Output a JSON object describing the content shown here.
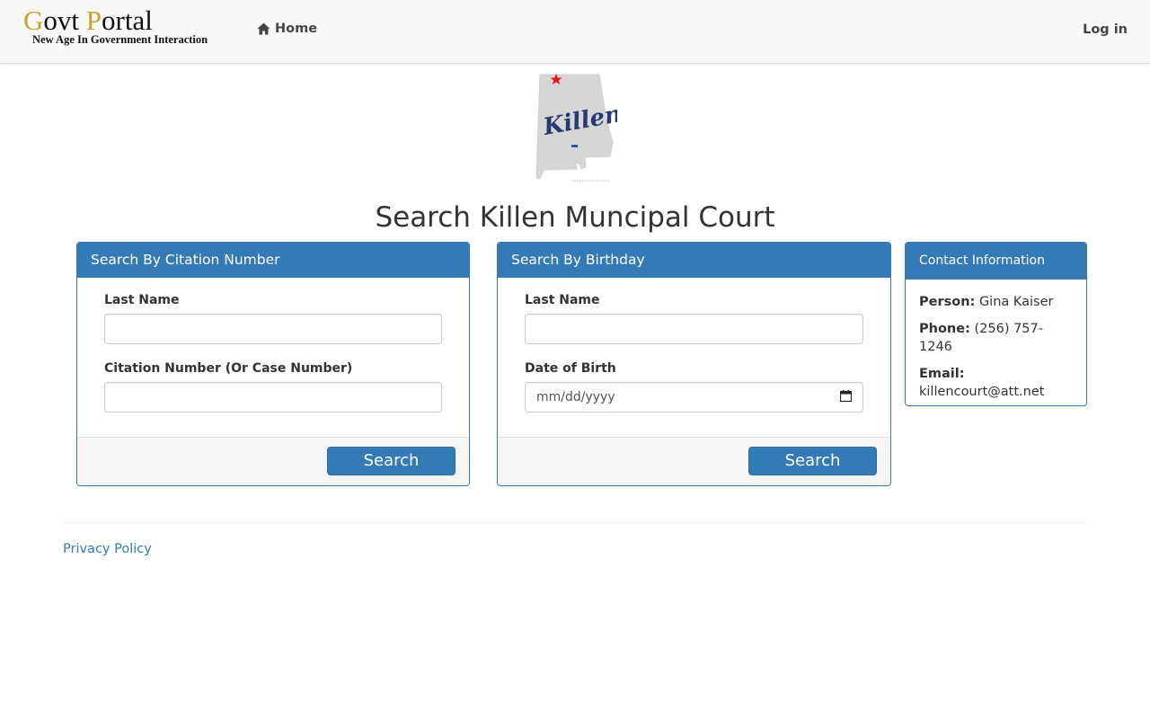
{
  "navbar": {
    "brand_name_parts": [
      "G",
      "ovt ",
      "P",
      "ortal"
    ],
    "brand_tagline": "New Age In Government Interaction",
    "home_label": "Home",
    "login_label": "Log in",
    "accent_color": "#c9a227"
  },
  "logo": {
    "city_script": "Killen",
    "star_color": "#e8141b"
  },
  "page_title": "Search Killen Muncipal Court",
  "citation_search": {
    "heading": "Search By Citation Number",
    "last_name_label": "Last Name",
    "last_name_value": "",
    "citation_label": "Citation Number (Or Case Number)",
    "citation_value": "",
    "search_label": "Search"
  },
  "birthday_search": {
    "heading": "Search By Birthday",
    "last_name_label": "Last Name",
    "last_name_value": "",
    "dob_label": "Date of Birth",
    "dob_placeholder": "mm/dd/yyyy",
    "search_label": "Search"
  },
  "contact": {
    "heading": "Contact Information",
    "person_label": "Person:",
    "person_value": "Gina Kaiser",
    "phone_label": "Phone:",
    "phone_value": "(256) 757-1246",
    "email_label": "Email:",
    "email_value": "killencourt@att.net"
  },
  "footer": {
    "privacy_label": "Privacy Policy"
  },
  "colors": {
    "primary": "#337ab7",
    "navbar_bg": "#f8f8f8"
  }
}
